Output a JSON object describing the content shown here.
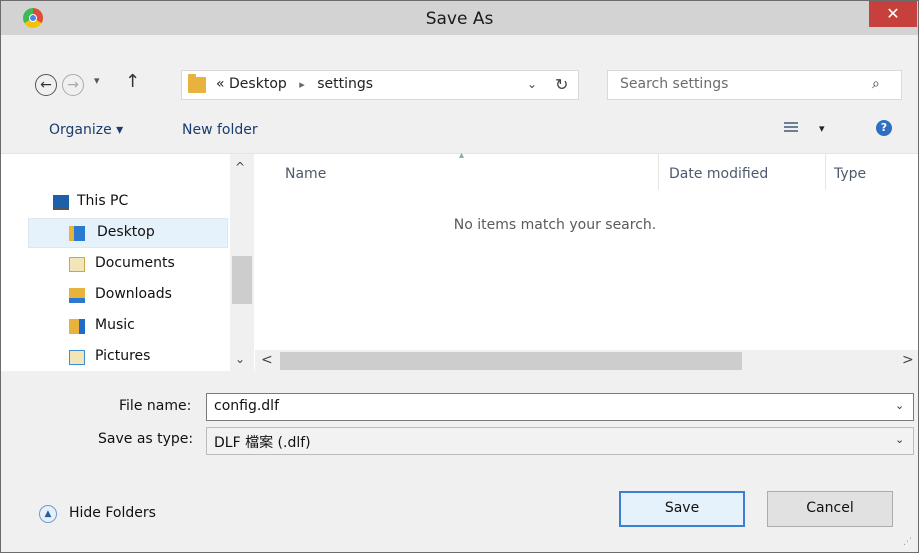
{
  "window": {
    "title": "Save As",
    "close_glyph": "✕"
  },
  "nav": {
    "back_glyph": "←",
    "forward_glyph": "→",
    "recent_glyph": "▾",
    "up_glyph": "↑",
    "breadcrumb": [
      "Desktop",
      "settings"
    ],
    "overflow_glyph": "«",
    "separator_glyph": "▸",
    "dropdown_glyph": "⌄",
    "refresh_glyph": "↻",
    "search_placeholder": "Search settings",
    "search_glyph": "⌕"
  },
  "toolbar": {
    "organize_label": "Organize ▾",
    "new_folder_label": "New folder",
    "view_dropdown_glyph": "▾",
    "help_glyph": "?"
  },
  "sidebar": {
    "this_pc": "This PC",
    "items": [
      {
        "label": "Desktop",
        "icon": "desktop-icon",
        "selected": true
      },
      {
        "label": "Documents",
        "icon": "documents-icon"
      },
      {
        "label": "Downloads",
        "icon": "downloads-icon"
      },
      {
        "label": "Music",
        "icon": "music-icon"
      },
      {
        "label": "Pictures",
        "icon": "pictures-icon"
      }
    ],
    "scroll_up_glyph": "^",
    "scroll_down_glyph": "⌄"
  },
  "filelist": {
    "columns": [
      "Name",
      "Date modified",
      "Type"
    ],
    "sort_glyph": "▴",
    "empty_message": "No items match your search.",
    "scroll_left_glyph": "<",
    "scroll_right_glyph": ">"
  },
  "form": {
    "file_name_label": "File name:",
    "file_name_value": "config.dlf",
    "save_type_label": "Save as type:",
    "save_type_value": "DLF 檔案 (.dlf)",
    "chevron_glyph": "⌄"
  },
  "footer": {
    "hide_folders_label": "Hide Folders",
    "hide_folders_glyph": "▲",
    "save_label": "Save",
    "cancel_label": "Cancel",
    "grip_glyph": "⋰"
  }
}
